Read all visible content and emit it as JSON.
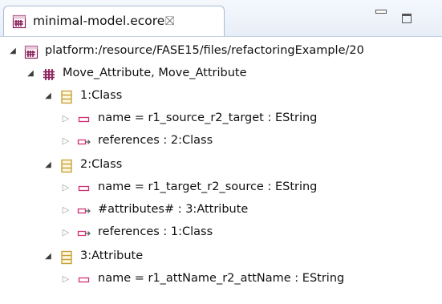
{
  "tab": {
    "title": "minimal-model.ecore",
    "close_glyph": "⛝",
    "icon": "ecore-file-icon"
  },
  "toolbar": {
    "minimize_icon": "minimize-icon",
    "maximize_icon": "maximize-icon"
  },
  "tree": {
    "resource": {
      "label": "platform:/resource/FASE15/files/refactoringExample/20",
      "icon": "ecore-resource-icon",
      "expanded": true
    },
    "rule": {
      "label": "Move_Attribute, Move_Attribute",
      "icon": "rule-icon",
      "expanded": true
    },
    "nodes": [
      {
        "label": "1:Class",
        "icon": "node-icon",
        "children": [
          {
            "label": "name = r1_source_r2_target : EString",
            "icon": "attribute-icon"
          },
          {
            "label": "references : 2:Class",
            "icon": "reference-icon"
          }
        ]
      },
      {
        "label": "2:Class",
        "icon": "node-icon",
        "children": [
          {
            "label": "name = r1_target_r2_source : EString",
            "icon": "attribute-icon"
          },
          {
            "label": "#attributes# : 3:Attribute",
            "icon": "reference-icon"
          },
          {
            "label": "references : 1:Class",
            "icon": "reference-icon"
          }
        ]
      },
      {
        "label": "3:Attribute",
        "icon": "node-icon",
        "children": [
          {
            "label": "name = r1_attName_r2_attName : EString",
            "icon": "attribute-icon"
          }
        ]
      }
    ]
  },
  "colors": {
    "ecore_icon": "#8a1f5c",
    "node_icon": "#c8a23c",
    "attr_icon": "#cc3377",
    "tab_border": "#a9bcd5"
  }
}
